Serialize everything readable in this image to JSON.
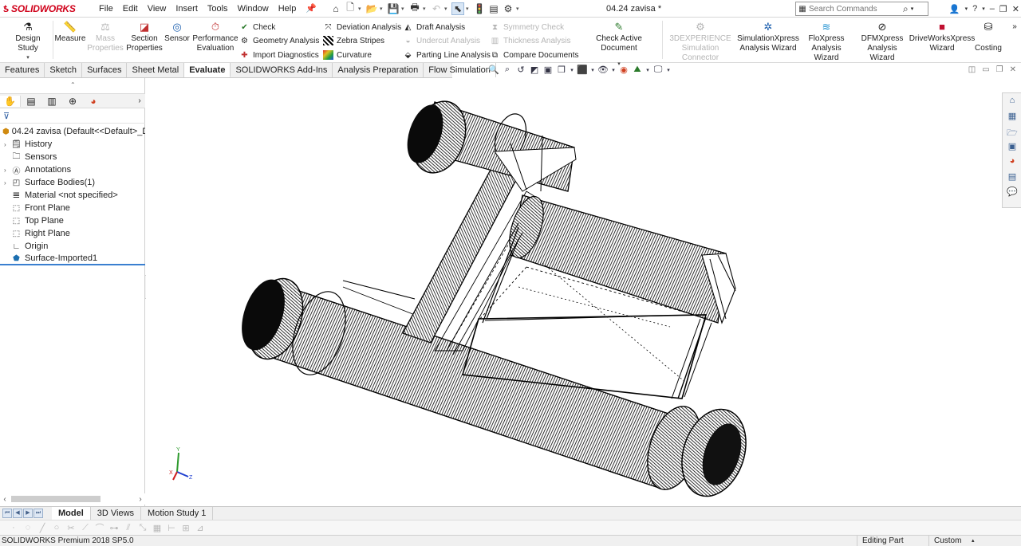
{
  "app": {
    "brand": "SOLIDWORKS",
    "doc_title": "04.24 zavisa *"
  },
  "menu": [
    "File",
    "Edit",
    "View",
    "Insert",
    "Tools",
    "Window",
    "Help"
  ],
  "search": {
    "placeholder": "Search Commands"
  },
  "ribbon": {
    "design_study": "Design Study",
    "measure": "Measure",
    "mass_properties_1": "Mass",
    "mass_properties_2": "Properties",
    "section_properties_1": "Section",
    "section_properties_2": "Properties",
    "sensor": "Sensor",
    "performance_1": "Performance",
    "performance_2": "Evaluation",
    "check": "Check",
    "geometry_analysis": "Geometry Analysis",
    "import_diagnostics": "Import Diagnostics",
    "deviation_analysis": "Deviation Analysis",
    "zebra_stripes": "Zebra Stripes",
    "curvature": "Curvature",
    "draft_analysis": "Draft Analysis",
    "undercut_analysis": "Undercut Analysis",
    "parting_line_analysis": "Parting Line Analysis",
    "symmetry_check": "Symmetry Check",
    "thickness_analysis": "Thickness Analysis",
    "compare_documents": "Compare Documents",
    "check_active_document": "Check Active Document",
    "threedx_1": "3DEXPERIENCE",
    "threedx_2": "Simulation Connector",
    "simxpress_1": "SimulationXpress",
    "simxpress_2": "Analysis Wizard",
    "floxpress_1": "FloXpress",
    "floxpress_2": "Analysis Wizard",
    "dfmxpress_1": "DFMXpress",
    "dfmxpress_2": "Analysis Wizard",
    "driveworks_1": "DriveWorksXpress",
    "driveworks_2": "Wizard",
    "costing": "Costing"
  },
  "tabs": [
    "Features",
    "Sketch",
    "Surfaces",
    "Sheet Metal",
    "Evaluate",
    "SOLIDWORKS Add-Ins",
    "Analysis Preparation",
    "Flow Simulation"
  ],
  "active_tab": "Evaluate",
  "tree": {
    "root": "04.24 zavisa  (Default<<Default>_Di",
    "items": [
      {
        "label": "History",
        "expandable": true
      },
      {
        "label": "Sensors",
        "expandable": false
      },
      {
        "label": "Annotations",
        "expandable": true
      },
      {
        "label": "Surface Bodies(1)",
        "expandable": true
      },
      {
        "label": "Material <not specified>",
        "expandable": false
      },
      {
        "label": "Front Plane",
        "expandable": false
      },
      {
        "label": "Top Plane",
        "expandable": false
      },
      {
        "label": "Right Plane",
        "expandable": false
      },
      {
        "label": "Origin",
        "expandable": false
      },
      {
        "label": "Surface-Imported1",
        "expandable": false
      }
    ]
  },
  "triad": {
    "x": "X",
    "y": "Y",
    "z": "Z"
  },
  "bottom_tabs": [
    "Model",
    "3D Views",
    "Motion Study 1"
  ],
  "active_bottom_tab": "Model",
  "status": {
    "product": "SOLIDWORKS Premium 2018 SP5.0",
    "mode": "Editing Part",
    "units": "Custom"
  }
}
